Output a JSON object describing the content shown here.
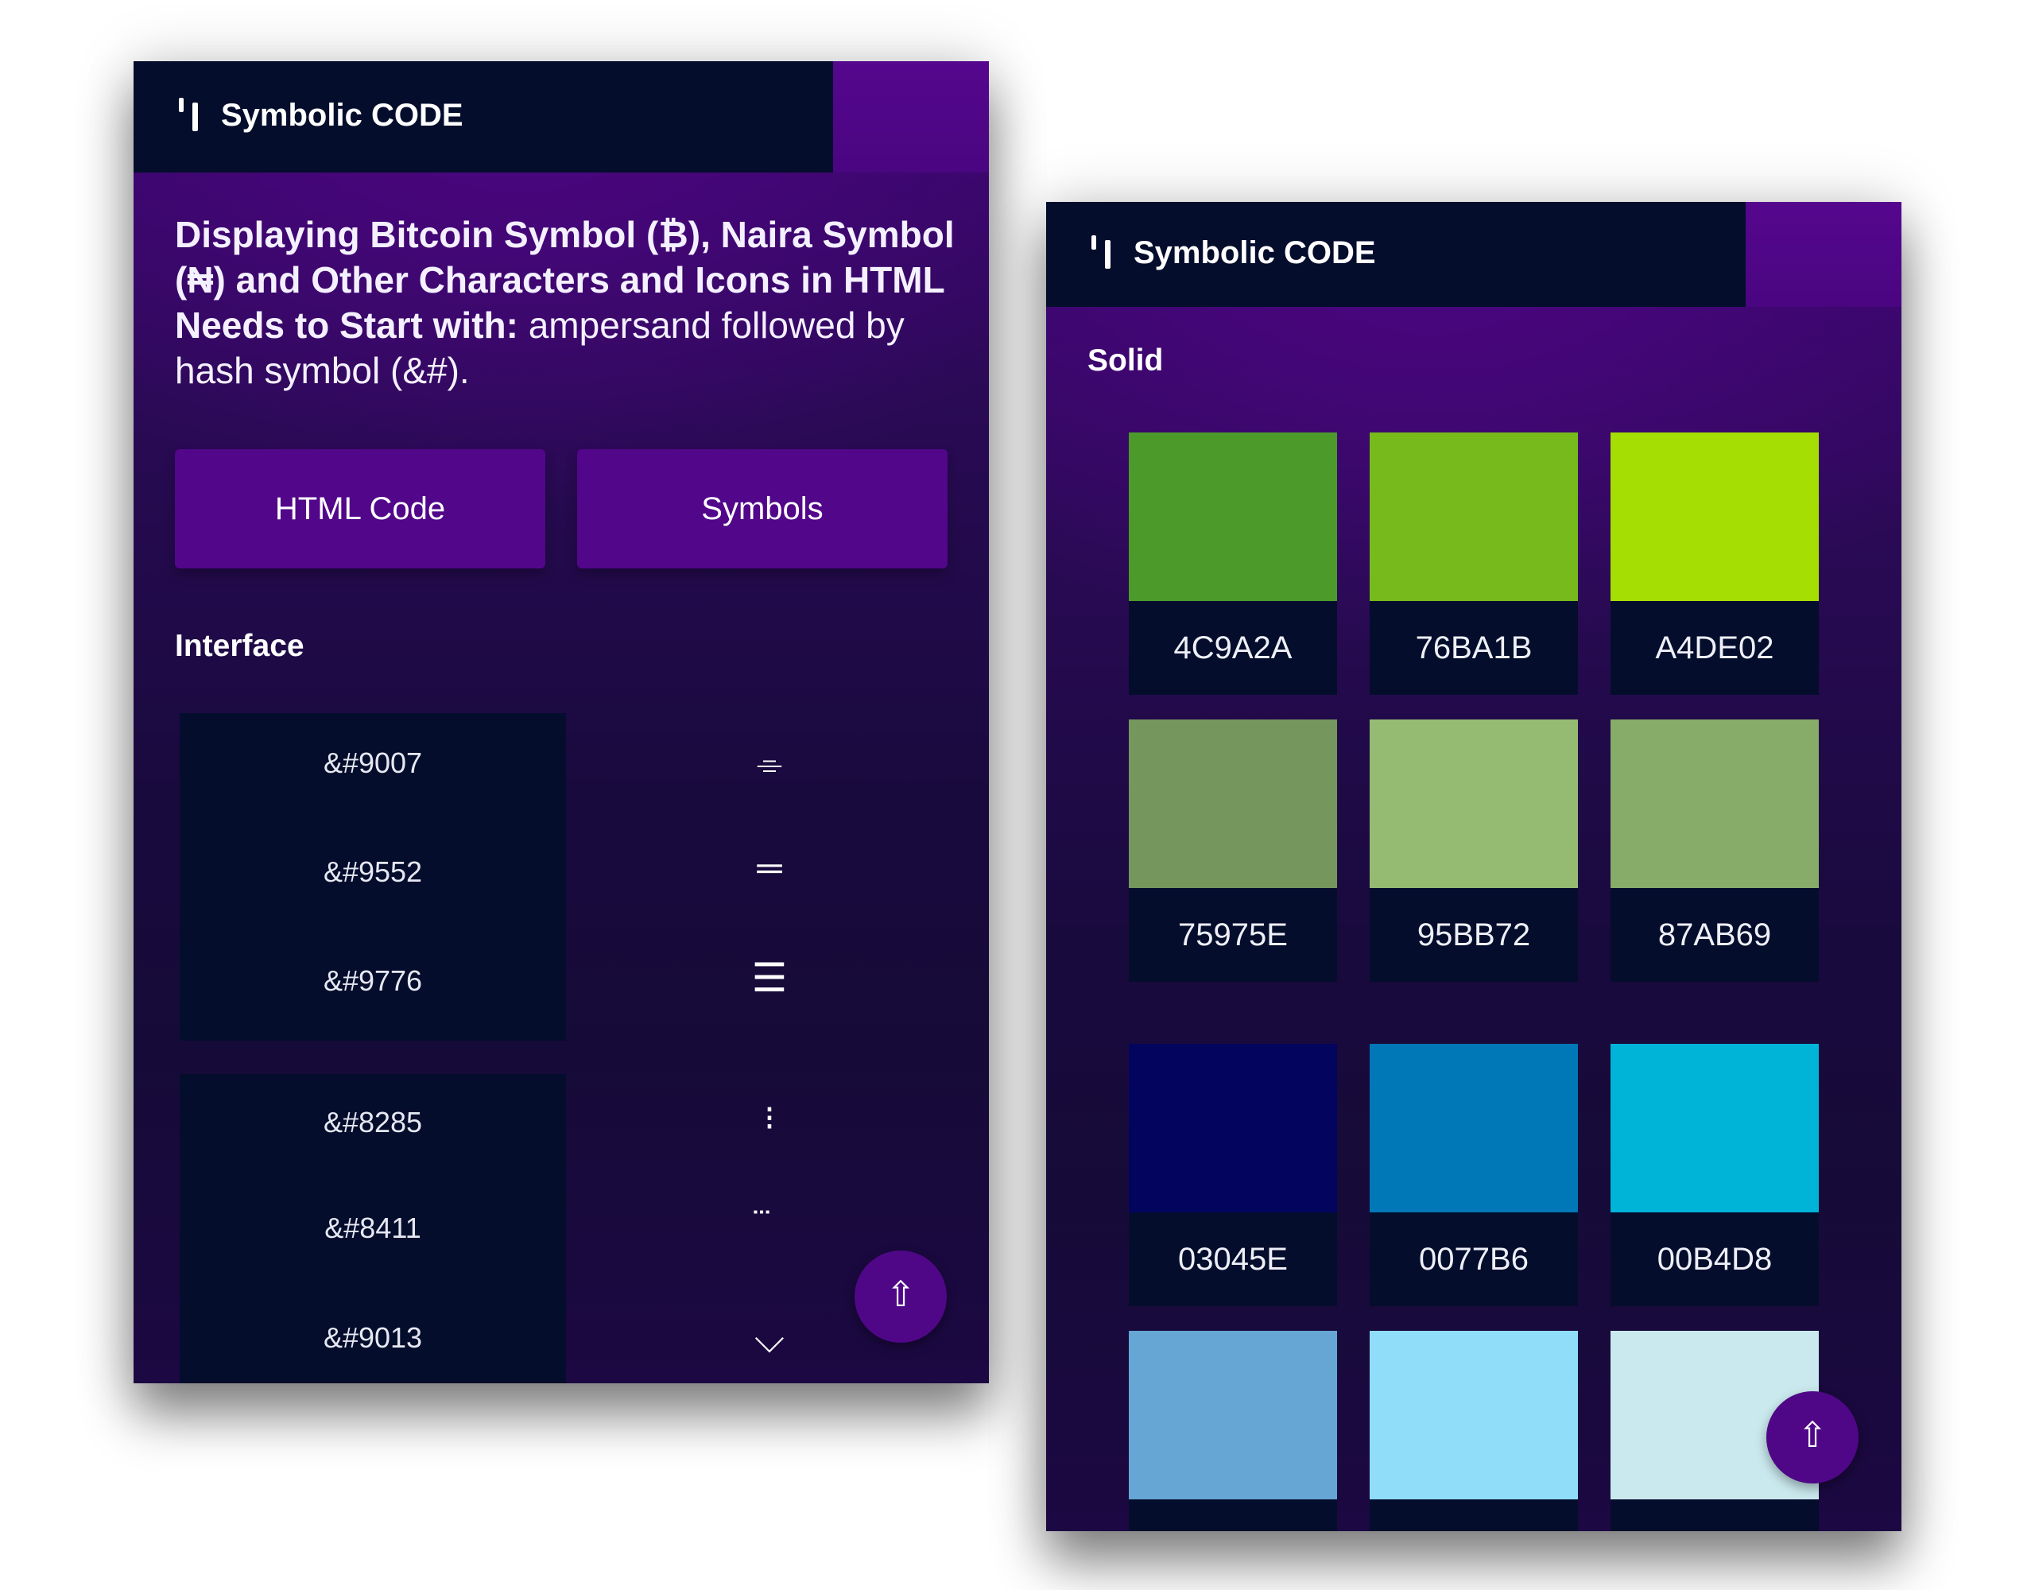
{
  "left_screen": {
    "brand": "Symbolic CODE",
    "intro": {
      "bold": "Displaying Bitcoin Symbol (₿), Naira Symbol (₦) and Other Characters and Icons in HTML Needs to Start with:",
      "normal": " ampersand followed by hash symbol (&#)."
    },
    "buttons": {
      "html_code": "HTML Code",
      "symbols": "Symbols"
    },
    "section_title": "Interface",
    "rows": [
      {
        "code": "&#9007",
        "symbol": "⌯"
      },
      {
        "code": "&#9552",
        "symbol": "═"
      },
      {
        "code": "&#9776",
        "symbol": "☰"
      },
      {
        "code": "&#8285",
        "symbol": "⁝"
      },
      {
        "code": "&#8411",
        "symbol": "⃛"
      },
      {
        "code": "&#9013",
        "symbol": "⌵"
      }
    ],
    "scroll_top_glyph": "⇧"
  },
  "right_screen": {
    "brand": "Symbolic CODE",
    "section_title": "Solid",
    "swatches": [
      {
        "hex": "4C9A2A",
        "color": "#4C9A2A"
      },
      {
        "hex": "76BA1B",
        "color": "#76BA1B"
      },
      {
        "hex": "A4DE02",
        "color": "#A4DE02"
      },
      {
        "hex": "75975E",
        "color": "#75975E"
      },
      {
        "hex": "95BB72",
        "color": "#95BB72"
      },
      {
        "hex": "87AB69",
        "color": "#87AB69"
      },
      {
        "hex": "03045E",
        "color": "#03045E"
      },
      {
        "hex": "0077B6",
        "color": "#0077B6"
      },
      {
        "hex": "00B4D8",
        "color": "#00B4D8"
      },
      {
        "hex": "",
        "color": "#66A6D4"
      },
      {
        "hex": "",
        "color": "#90DDFA"
      },
      {
        "hex": "",
        "color": "#CAE9EE"
      }
    ],
    "scroll_top_glyph": "⇧"
  },
  "colors": {
    "topbar": "#050d2c",
    "accent_purple": "#52068a",
    "code_cell": "#050d2c"
  }
}
